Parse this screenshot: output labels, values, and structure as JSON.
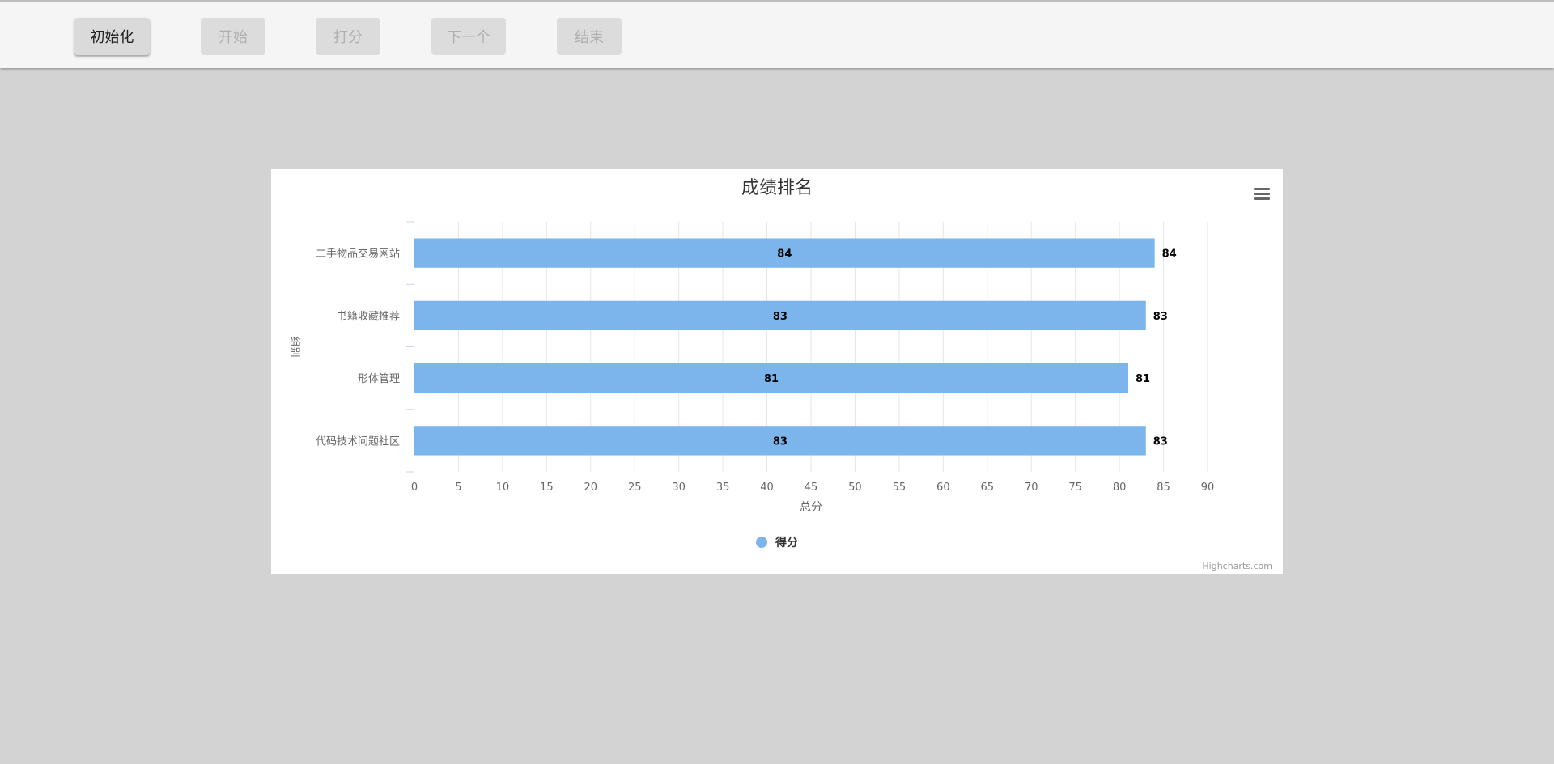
{
  "toolbar": {
    "buttons": [
      {
        "label": "初始化",
        "enabled": true
      },
      {
        "label": "开始",
        "enabled": false
      },
      {
        "label": "打分",
        "enabled": false
      },
      {
        "label": "下一个",
        "enabled": false
      },
      {
        "label": "结束",
        "enabled": false
      }
    ]
  },
  "chart_data": {
    "type": "bar",
    "orientation": "horizontal",
    "title": "成绩排名",
    "xlabel": "组别",
    "ylabel": "总分",
    "categories": [
      "二手物品交易网站",
      "书籍收藏推荐",
      "形体管理",
      "代码技术问题社区"
    ],
    "series": [
      {
        "name": "得分",
        "values": [
          84,
          83,
          81,
          83
        ],
        "color": "#7cb5ec"
      }
    ],
    "ylim": [
      0,
      90
    ],
    "ticks": [
      "0",
      "5",
      "10",
      "15",
      "20",
      "25",
      "30",
      "35",
      "40",
      "45",
      "50",
      "55",
      "60",
      "65",
      "70",
      "75",
      "80",
      "85",
      "90"
    ],
    "grid": true,
    "legend": "bottom-center",
    "credits": "Highcharts.com"
  },
  "colors": {
    "bar": "#7cb5ec",
    "grid": "#e6e6e6",
    "axis_text": "#666666",
    "title_text": "#333333"
  }
}
